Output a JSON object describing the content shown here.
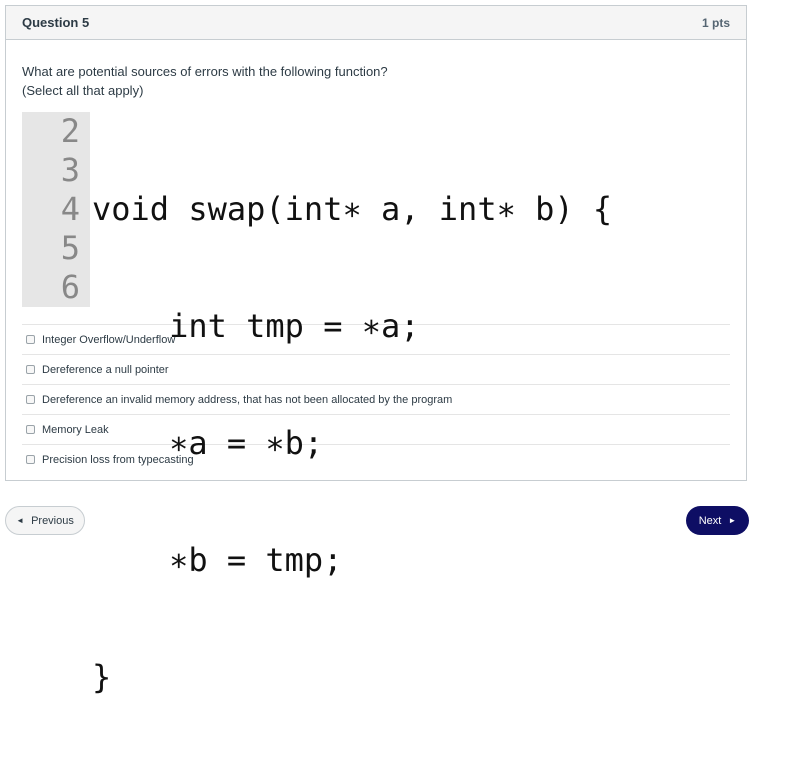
{
  "question": {
    "title": "Question 5",
    "points": "1 pts",
    "prompt_line1": "What are potential sources of errors with the following function?",
    "prompt_line2": "(Select all that apply)"
  },
  "code": {
    "line_numbers": [
      "2",
      "3",
      "4",
      "5",
      "6"
    ],
    "lines": [
      "void swap(int∗ a, int∗ b) {",
      "    int tmp = ∗a;",
      "    ∗a = ∗b;",
      "    ∗b = tmp;",
      "}"
    ]
  },
  "answers": [
    "Integer Overflow/Underflow",
    "Dereference a null pointer",
    "Dereference an invalid memory address, that has not been allocated by the program",
    "Memory Leak",
    "Precision loss from typecasting"
  ],
  "nav": {
    "previous_label": "Previous",
    "next_label": "Next",
    "previous_arrow": "◄",
    "next_arrow": "►"
  }
}
